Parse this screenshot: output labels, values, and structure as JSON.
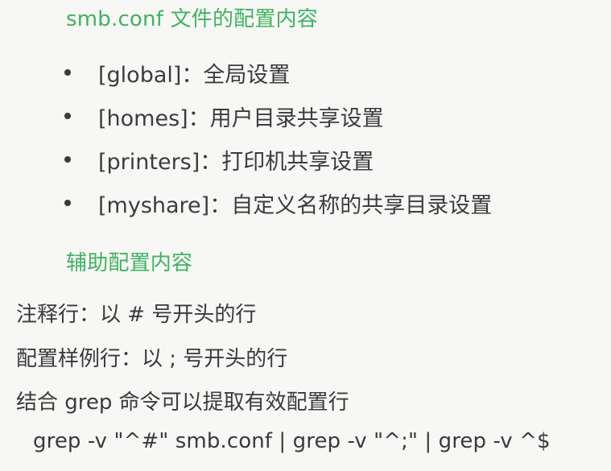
{
  "section1": {
    "title": "smb.conf 文件的配置内容",
    "items": [
      "[global]：全局设置",
      "[homes]：用户目录共享设置",
      "[printers]：打印机共享设置",
      "[myshare]：自定义名称的共享目录设置"
    ]
  },
  "section2": {
    "title": "辅助配置内容",
    "lines": [
      "注释行：以 # 号开头的行",
      "配置样例行：以 ; 号开头的行",
      "结合 grep 命令可以提取有效配置行"
    ],
    "command": "grep -v \"^#\" smb.conf | grep -v \"^;\" | grep -v ^$"
  },
  "colors": {
    "heading": "#3fb35f",
    "text": "#3a3a3a",
    "background": "#f7f7f6"
  }
}
